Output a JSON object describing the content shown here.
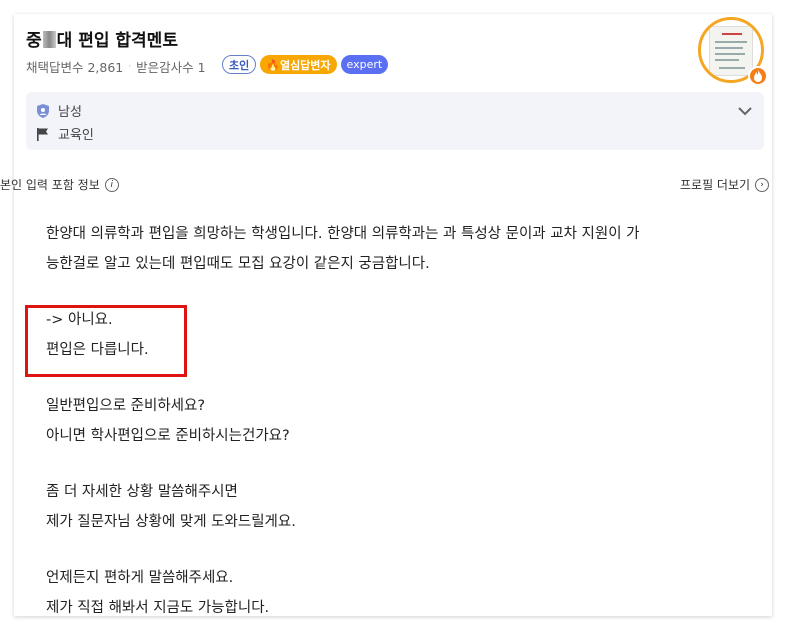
{
  "question": {
    "title_prefix": "중",
    "title_suffix": "대 편입 합격멘토",
    "stats_adopted": "채택답변수 2,861",
    "stats_sep": "·",
    "stats_thanks": "받은감사수 1",
    "badges": {
      "rank": "초인",
      "hot": "🔥열심답변자",
      "expert": "expert"
    }
  },
  "profile": {
    "gender": "남성",
    "job": "교육인"
  },
  "infobar": {
    "left": "본인 입력 포함 정보",
    "info_icon": "i",
    "right": "프로필 더보기"
  },
  "answer": {
    "lines": [
      "한양대 의류학과 편입을 희망하는 학생입니다. 한양대 의류학과는 과 특성상 문이과 교차 지원이 가",
      "능한걸로 알고 있는데 편입때도 모집 요강이 같은지 궁금합니다.",
      "-> 아니요.",
      "편입은 다릅니다.",
      "일반편입으로 준비하세요?",
      "아니면 학사편입으로 준비하시는건가요?",
      "좀 더 자세한 상황 말씀해주시면",
      "제가 질문자님 상황에 맞게 도와드릴게요.",
      "언제든지 편하게 말씀해주세요.",
      "제가 직접 해봐서 지금도 가능합니다."
    ]
  },
  "icons": {
    "shield": "shield-icon",
    "flag": "flag-icon",
    "chevron": "chevron-down-icon",
    "fire": "fire-icon"
  },
  "colors": {
    "accent_blue": "#5b6ff2",
    "hot_orange": "#f7a700",
    "avatar_ring": "#f5a623",
    "highlight_red": "#e01313",
    "profile_bg": "#f2f4fa"
  }
}
